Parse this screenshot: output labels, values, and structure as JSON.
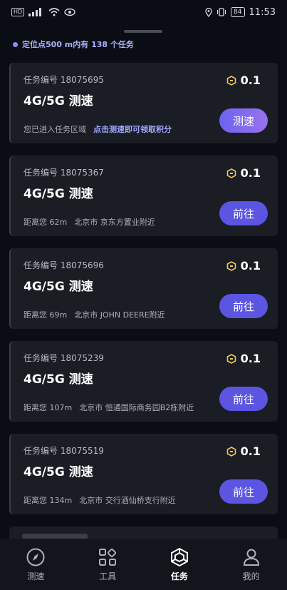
{
  "status_bar": {
    "network_badge": "HD",
    "battery": "84",
    "time": "11:53"
  },
  "location_info": "定位点500 m内有 138 个任务",
  "tasks": [
    {
      "no": "任务编号 18075695",
      "name": "4G/5G 测速",
      "reward": "0.1",
      "desc1": "您已进入任务区域",
      "desc2": "点击测速即可领取积分",
      "button": "测速"
    },
    {
      "no": "任务编号 18075367",
      "name": "4G/5G 测速",
      "reward": "0.1",
      "desc1": "距离您 62m",
      "desc2": "北京市 京东方置业附近",
      "button": "前往"
    },
    {
      "no": "任务编号 18075696",
      "name": "4G/5G 测速",
      "reward": "0.1",
      "desc1": "距离您 69m",
      "desc2": "北京市 JOHN DEERE附近",
      "button": "前往"
    },
    {
      "no": "任务编号 18075239",
      "name": "4G/5G 测速",
      "reward": "0.1",
      "desc1": "距离您 107m",
      "desc2": "北京市 恒通国际商务园B2栋附近",
      "button": "前往"
    },
    {
      "no": "任务编号 18075519",
      "name": "4G/5G 测速",
      "reward": "0.1",
      "desc1": "距离您 134m",
      "desc2": "北京市 交行酒仙桥支行附近",
      "button": "前往"
    }
  ],
  "nav": {
    "speedtest": "测速",
    "tools": "工具",
    "tasks": "任务",
    "mine": "我的"
  },
  "colors": {
    "accent": "#5b55e2",
    "highlight": "#9fa9ff",
    "background": "#0b0d14",
    "card": "#1b1d25",
    "reward_icon": "#f0c860"
  }
}
